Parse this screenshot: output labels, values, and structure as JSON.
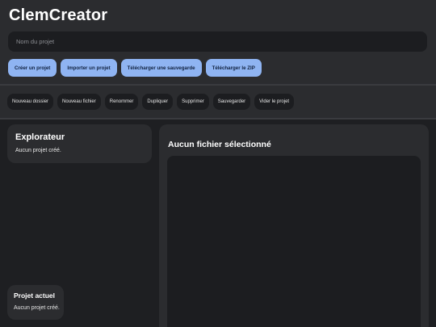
{
  "app": {
    "title": "ClemCreator"
  },
  "project_input": {
    "placeholder": "Nom du projet",
    "value": ""
  },
  "primary_actions": {
    "create": "Créer un projet",
    "import": "Importer un projet",
    "download_save": "Télécharger une sauvegarde",
    "download_zip": "Télécharger le ZIP"
  },
  "toolbar": {
    "new_folder": "Nouveau dossier",
    "new_file": "Nouveau fichier",
    "rename": "Renommer",
    "duplicate": "Dupliquer",
    "delete": "Supprimer",
    "save": "Sauvegarder",
    "clear_project": "Vider le projet"
  },
  "explorer": {
    "title": "Explorateur",
    "empty_text": "Aucun projet créé."
  },
  "current_project": {
    "title": "Projet actuel",
    "text": "Aucun projet créé."
  },
  "editor": {
    "title": "Aucun fichier sélectionné",
    "content": ""
  },
  "colors": {
    "background": "#1e1f22",
    "panel": "#2b2c2f",
    "field": "#1c1d20",
    "accent": "#8fb4f2",
    "accent_text": "#10213f"
  }
}
